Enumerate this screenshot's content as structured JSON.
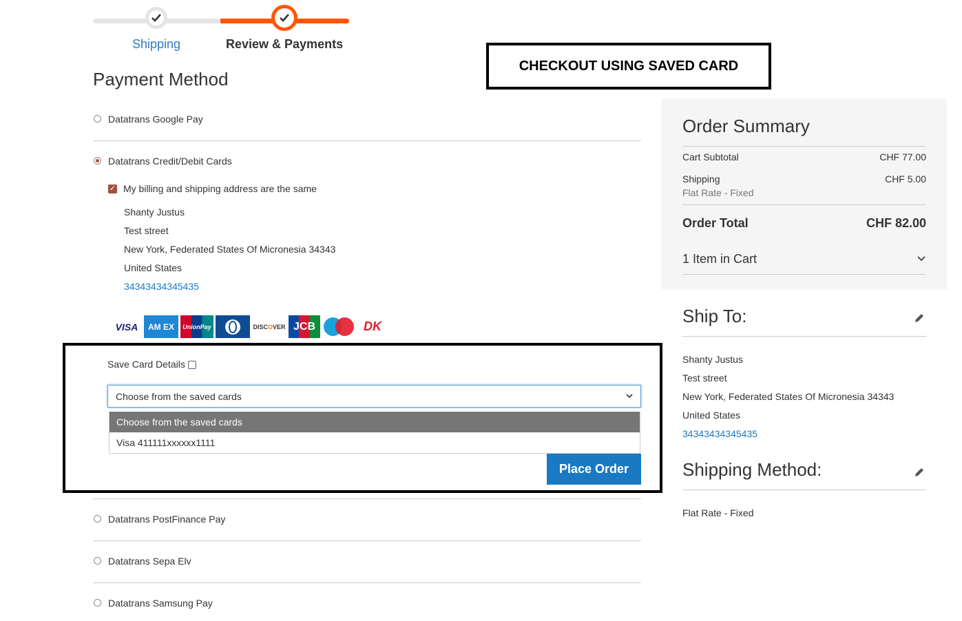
{
  "progress": {
    "steps": [
      {
        "label": "Shipping"
      },
      {
        "label": "Review & Payments"
      }
    ]
  },
  "callout": {
    "text": "CHECKOUT USING SAVED CARD"
  },
  "payment": {
    "title": "Payment Method",
    "methods": [
      {
        "label": "Datatrans Google Pay"
      },
      {
        "label": "Datatrans Credit/Debit Cards"
      },
      {
        "label": "Datatrans PostFinance Pay"
      },
      {
        "label": "Datatrans Sepa Elv"
      },
      {
        "label": "Datatrans Samsung Pay"
      }
    ],
    "billing_same_label": "My billing and shipping address are the same",
    "billing_address": {
      "name": "Shanty Justus",
      "street": "Test street",
      "city_line": "New York, Federated States Of Micronesia 34343",
      "country": "United States",
      "phone": "34343434345435"
    },
    "card_logos": [
      "VISA",
      "AMEX",
      "UnionPay",
      "Diners",
      "DISCOVER",
      "JCB",
      "Maestro",
      "Dankort"
    ],
    "save_card_label": "Save Card Details",
    "saved_cards_select": {
      "value": "Choose from the saved cards",
      "options": [
        "Choose from the saved cards",
        "Visa 411111xxxxxx1111"
      ]
    },
    "place_order_label": "Place Order"
  },
  "summary": {
    "title": "Order Summary",
    "subtotal_label": "Cart Subtotal",
    "subtotal_value": "CHF 77.00",
    "shipping_label": "Shipping",
    "shipping_method": "Flat Rate - Fixed",
    "shipping_value": "CHF 5.00",
    "total_label": "Order Total",
    "total_value": "CHF 82.00",
    "items_label": "1 Item in Cart"
  },
  "ship_to": {
    "title": "Ship To:",
    "name": "Shanty Justus",
    "street": "Test street",
    "city_line": "New York, Federated States Of Micronesia 34343",
    "country": "United States",
    "phone": "34343434345435"
  },
  "shipping_method": {
    "title": "Shipping Method:",
    "value": "Flat Rate - Fixed"
  },
  "colors": {
    "accent": "#ff5501",
    "primary_button": "#1979c3",
    "link": "#1979c3"
  }
}
